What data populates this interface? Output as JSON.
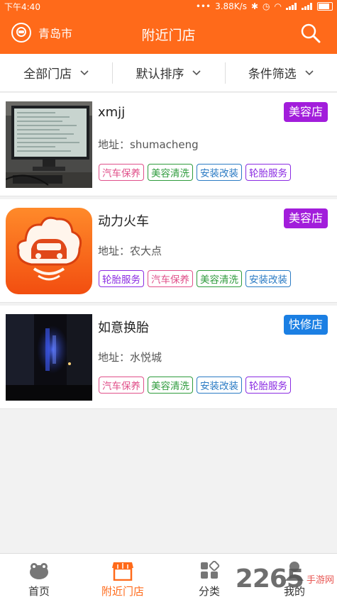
{
  "status": {
    "time": "下午4:40",
    "speed": "3.88K/s"
  },
  "header": {
    "city": "青岛市",
    "title": "附近门店"
  },
  "filters": [
    {
      "label": "全部门店"
    },
    {
      "label": "默认排序"
    },
    {
      "label": "条件筛选"
    }
  ],
  "stores": [
    {
      "name": "xmjj",
      "address": "地址：shumacheng",
      "category": "美容店",
      "category_color": "#a21ddb",
      "tags": [
        "汽车保养",
        "美容清洗",
        "安装改装",
        "轮胎服务"
      ]
    },
    {
      "name": "动力火车",
      "address": "地址：农大点",
      "category": "美容店",
      "category_color": "#a21ddb",
      "tags": [
        "轮胎服务",
        "汽车保养",
        "美容清洗",
        "安装改装"
      ]
    },
    {
      "name": "如意换胎",
      "address": "地址：水悦城",
      "category": "快修店",
      "category_color": "#1b7fe3",
      "tags": [
        "汽车保养",
        "美容清洗",
        "安装改装",
        "轮胎服务"
      ]
    }
  ],
  "tag_colors": {
    "汽车保养": "#e0508a",
    "美容清洗": "#2e9b3c",
    "安装改装": "#2b7bc4",
    "轮胎服务": "#8a2be2"
  },
  "tabs": [
    {
      "label": "首页",
      "icon": "home-icon"
    },
    {
      "label": "附近门店",
      "icon": "store-icon"
    },
    {
      "label": "分类",
      "icon": "category-icon"
    },
    {
      "label": "我的",
      "icon": "profile-icon"
    }
  ],
  "watermark": {
    "number": "2265",
    "text": "手游网"
  },
  "colors": {
    "accent": "#ff6a1a"
  }
}
